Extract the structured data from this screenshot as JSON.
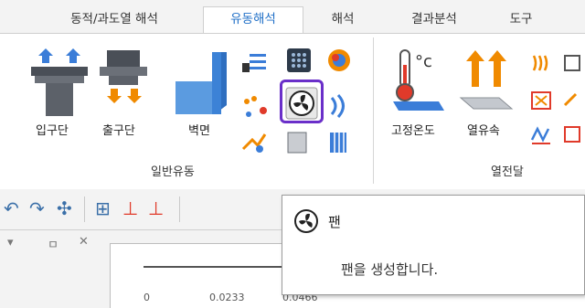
{
  "tabs": [
    {
      "label": "동적/과도열 해석",
      "active": false
    },
    {
      "label": "유동해석",
      "active": true
    },
    {
      "label": "해석",
      "active": false
    },
    {
      "label": "결과분석",
      "active": false
    },
    {
      "label": "도구",
      "active": false
    }
  ],
  "ribbon": {
    "flow_group": {
      "label": "일반유동",
      "buttons": {
        "inlet": "입구단",
        "outlet": "출구단",
        "wall": "벽면"
      }
    },
    "heat_group": {
      "label": "열전달",
      "buttons": {
        "fixed_temp": "고정온도",
        "heat_flux": "열유속"
      }
    }
  },
  "tooltip": {
    "title": "팬",
    "description": "팬을 생성합니다.",
    "icon": "fan-icon"
  },
  "panel": {
    "pin_glyph": "ㅁ",
    "close_glyph": "✕",
    "scale_ticks": [
      "0",
      "0.0233",
      "0.0466"
    ]
  },
  "colors": {
    "active_tab": "#1f6fc7",
    "highlight": "#6a2fc9",
    "arrow_orange": "#f08a00",
    "icon_blue": "#3b7dd8"
  }
}
